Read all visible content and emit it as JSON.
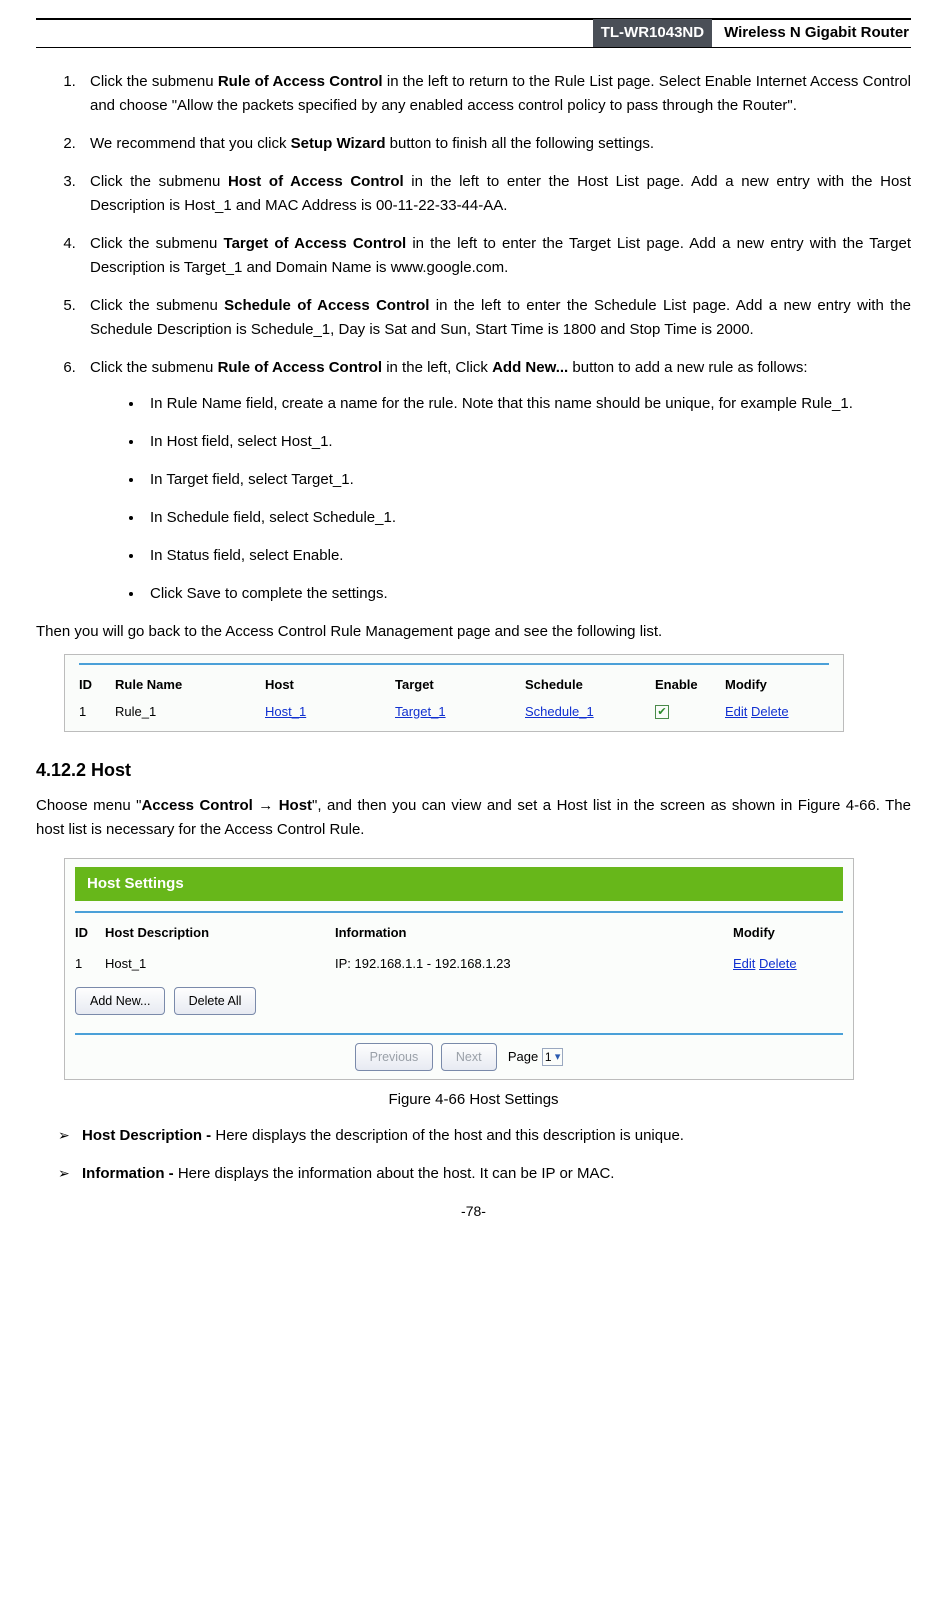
{
  "header": {
    "model": "TL-WR1043ND",
    "desc": "Wireless N Gigabit Router"
  },
  "steps": {
    "s1_a": "Click the submenu ",
    "s1_b": "Rule of Access Control",
    "s1_c": " in the left to return to the Rule List page. Select Enable Internet Access Control and choose \"Allow the packets specified by any enabled access control policy to pass through the Router\".",
    "s2_a": "We recommend that you click ",
    "s2_b": "Setup Wizard",
    "s2_c": " button to finish all the following settings.",
    "s3_a": "Click the submenu ",
    "s3_b": "Host of Access Control",
    "s3_c": " in the left to enter the Host List page. Add a new entry with the Host Description is Host_1 and MAC Address is 00-11-22-33-44-AA.",
    "s4_a": "Click the submenu ",
    "s4_b": "Target of Access Control",
    "s4_c": " in the left to enter the Target List page. Add a new entry with the Target Description is Target_1 and Domain Name is www.google.com.",
    "s5_a": "Click the submenu ",
    "s5_b": "Schedule of Access Control",
    "s5_c": " in the left to enter the Schedule List page. Add a new entry with the Schedule Description is Schedule_1, Day is Sat and Sun, Start Time is 1800 and Stop Time is 2000.",
    "s6_a": "Click the submenu ",
    "s6_b": "Rule of Access Control",
    "s6_c": " in the left, Click ",
    "s6_d": "Add New...",
    "s6_e": " button to add a new rule as follows:"
  },
  "bullets": {
    "b1": "In Rule Name field, create a name for the rule. Note that this name should be unique, for example Rule_1.",
    "b2": "In Host field, select Host_1.",
    "b3": "In Target field, select Target_1.",
    "b4": "In Schedule field, select Schedule_1.",
    "b5": "In Status field, select Enable.",
    "b6": "Click Save to complete the settings."
  },
  "after_para": "Then you will go back to the Access Control Rule Management page and see the following list.",
  "rule_table": {
    "headers": {
      "id": "ID",
      "name": "Rule Name",
      "host": "Host",
      "target": "Target",
      "schedule": "Schedule",
      "enable": "Enable",
      "modify": "Modify"
    },
    "row": {
      "id": "1",
      "name": "Rule_1",
      "host": "Host_1",
      "target": "Target_1",
      "schedule": "Schedule_1",
      "edit": "Edit",
      "delete": "Delete"
    }
  },
  "section": {
    "num_title": "4.12.2  Host",
    "intro_a": "Choose menu \"",
    "intro_b": "Access Control → Host",
    "intro_c": "\", and then you can view and set a Host list in the screen as shown in Figure 4-66. The host list is necessary for the Access Control Rule."
  },
  "host_panel": {
    "title": "Host Settings",
    "headers": {
      "id": "ID",
      "desc": "Host Description",
      "info": "Information",
      "modify": "Modify"
    },
    "row": {
      "id": "1",
      "desc": "Host_1",
      "info": "IP: 192.168.1.1 - 192.168.1.23",
      "edit": "Edit",
      "delete": "Delete"
    },
    "btn_addnew": "Add New...",
    "btn_deleteall": "Delete All",
    "btn_prev": "Previous",
    "btn_next": "Next",
    "page_label": "Page",
    "page_value": "1"
  },
  "fig_caption": "Figure 4-66    Host Settings",
  "desc_items": {
    "d1_label": "Host Description - ",
    "d1_text": "Here displays the description of the host and this description is unique.",
    "d2_label": "Information - ",
    "d2_text": "Here displays the information about the host. It can be IP or MAC."
  },
  "page_number": "-78-"
}
